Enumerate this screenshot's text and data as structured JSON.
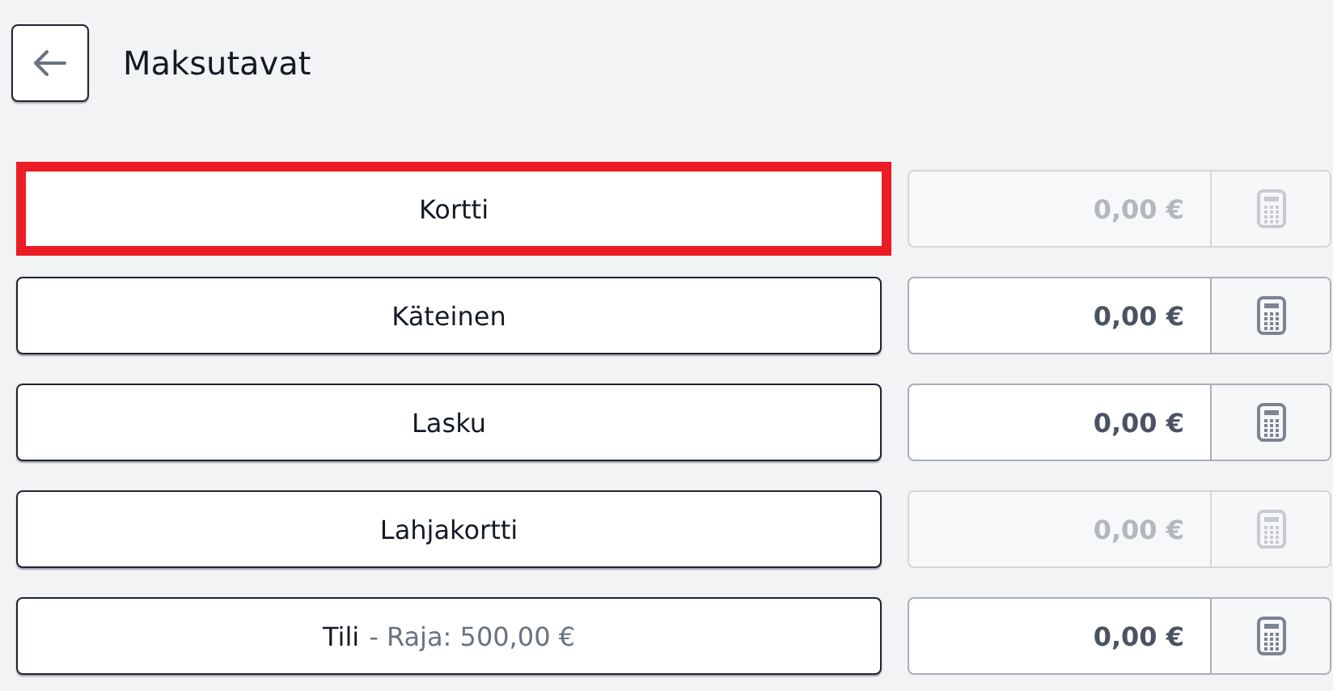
{
  "header": {
    "title": "Maksutavat"
  },
  "methods": [
    {
      "label": "Kortti",
      "selected": true,
      "amount": "0,00 €",
      "disabled": true
    },
    {
      "label": "Käteinen",
      "selected": false,
      "amount": "0,00 €",
      "disabled": false
    },
    {
      "label": "Lasku",
      "selected": false,
      "amount": "0,00 €",
      "disabled": false
    },
    {
      "label": "Lahjakortti",
      "selected": false,
      "amount": "0,00 €",
      "disabled": true
    },
    {
      "label": "Tili",
      "note": "- Raja: 500,00 €",
      "selected": false,
      "amount": "0,00 €",
      "disabled": false
    }
  ]
}
